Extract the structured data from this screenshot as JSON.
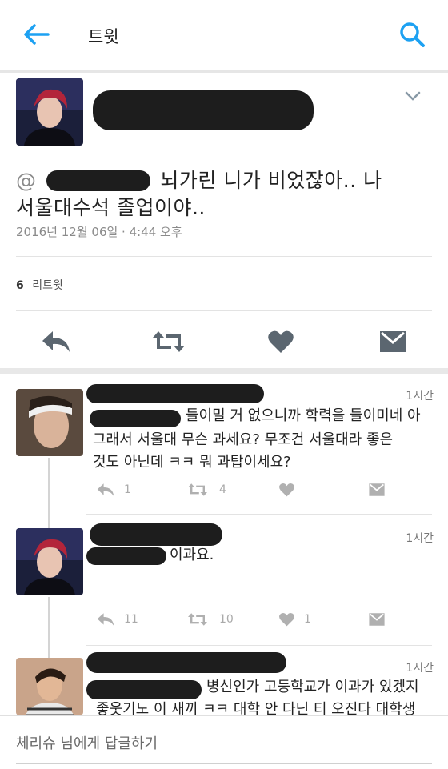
{
  "header": {
    "title": "트윗"
  },
  "tweet": {
    "text_line1": "뇌가린 니가 비었잖아.. 나",
    "text_line2": "서울대수석 졸업이야..",
    "mention_prefix": "@",
    "timestamp": "2016년 12월 06일 · 4:44 오후",
    "retweet_count": "6",
    "retweet_label": "리트윗"
  },
  "replies": [
    {
      "time": "1시간",
      "lines": [
        "들이밀 거 없으니까 학력을 들이미네 아",
        "그래서 서울대 무슨 과세요? 무조건 서울대라 좋은",
        "것도 아닌데 ㅋㅋ 뭐 과탑이세요?"
      ],
      "reply_count": "1",
      "retweet_count": "4",
      "like_count": ""
    },
    {
      "time": "1시간",
      "lines": [
        "이과요."
      ],
      "reply_count": "11",
      "retweet_count": "10",
      "like_count": "1"
    },
    {
      "time": "1시간",
      "lines": [
        "병신인가 고등학교가 이과가 있겠지",
        "좋웃기노 이 새끼 ㅋㅋ 대학 안 다닌 티 오진다 대학생"
      ]
    }
  ],
  "reply_box": {
    "placeholder": "체리슈 님에게 답글하기"
  },
  "colors": {
    "accent": "#1da1f2",
    "icon_gray": "#5b6670",
    "light_icon": "#b0b0b0",
    "redaction": "#1d1d1d"
  },
  "icons": [
    "back-arrow-icon",
    "search-icon",
    "chevron-down-icon",
    "reply-icon",
    "retweet-icon",
    "heart-icon",
    "dm-icon"
  ]
}
